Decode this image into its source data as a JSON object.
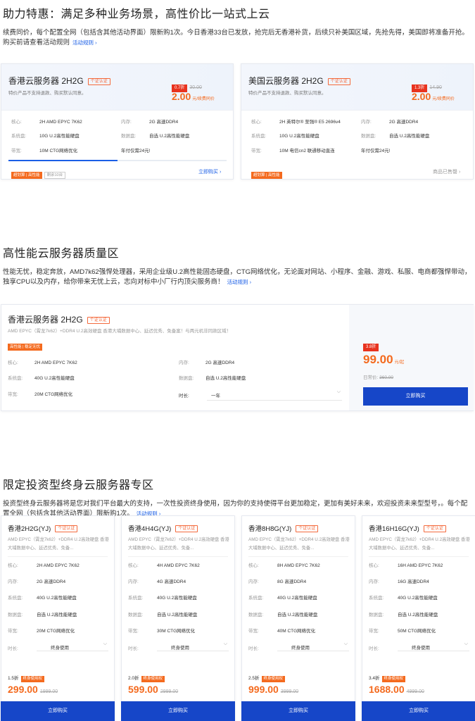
{
  "section1": {
    "title": "助力特惠：满足多种业务场景，高性价比一站式上云",
    "desc": "续费同价，每个配置全网（包括含其他活动界面）限新购1次。今日香港33台已发放，抢完后无香港补货，后续只补美国区域，先抢先得，美国即将准备开抢。购买前请查看活动规则",
    "rules_link": "活动规则 ›",
    "cards": [
      {
        "name": "香港云服务器 2H2G",
        "auth": "个证认证",
        "note": "特价产品不支持退款、购买默认同意。",
        "discount": "0.7折",
        "orig_price": "30.00",
        "price": "2.00",
        "unit": "元/续费同价",
        "specs": {
          "cpu_lbl": "核心:",
          "cpu": "2H AMD EPYC 7K62",
          "mem_lbl": "内存:",
          "mem": "2G 高速DDR4",
          "sys_lbl": "系统盘:",
          "sys": "10G U.2高性能硬盘",
          "data_lbl": "数据盘:",
          "data": "自选 U.2高性能硬盘",
          "bw_lbl": "带宽:",
          "bw": "10M CTG网络优化",
          "extra": "年付仅需24元!"
        },
        "tag1": "超划算 | 高性能",
        "tag2": "剩余10台",
        "progress": 0.5,
        "action": "立即购买 ›"
      },
      {
        "name": "美国云服务器 2H2G",
        "auth": "个证认证",
        "note": "特价产品不支持退款、购买默认同意。",
        "discount": "1.3折",
        "orig_price": "14.90",
        "price": "2.00",
        "unit": "元/续费同价",
        "specs": {
          "cpu_lbl": "核心:",
          "cpu": "2H 英特尔® 至强® E5 2696v4",
          "mem_lbl": "内存:",
          "mem": "2G 高速DDR4",
          "sys_lbl": "系统盘:",
          "sys": "10G U.2高性能硬盘",
          "data_lbl": "数据盘:",
          "data": "自选 U.2高性能硬盘",
          "bw_lbl": "带宽:",
          "bw": "10M 电信cn2 联通移动直连",
          "extra": "年付仅需24元!"
        },
        "tag1": "超划算 | 高性能",
        "action": "商品已售罄 ›"
      }
    ]
  },
  "section2": {
    "title": "高性能云服务器质量区",
    "desc": "性能无忧，稳定奔放，AMD7k62强悍处理器，采用企业级U.2高性能固态硬盘，CTG网络优化，无论面对网站、小程序、金融、游戏、私服、电商都强悍带动，独享CPU以及内存，给你带来无忧上云，志向对标中小厂行内顶尖服务商！",
    "rules_link": "活动规则 ›",
    "card": {
      "name": "香港云服务器 2H2G",
      "auth": "个证认证",
      "desc": "AMD EPYC（霄龙7k62）+DDR4 U.2高效硬盘 香港大埔数据中心、延迟优秀、免备案！与两元机非同款区域！",
      "tag": "高性能 | 稳定无忧",
      "cpu_lbl": "核心:",
      "cpu": "2H AMD EPYC 7K62",
      "mem_lbl": "内存:",
      "mem": "2G 高速DDR4",
      "sys_lbl": "系统盘:",
      "sys": "40G U.2高性能硬盘",
      "data_lbl": "数据盘:",
      "data": "自选 U.2高性能硬盘",
      "bw_lbl": "带宽:",
      "bw": "20M CTG网络优化",
      "dur_lbl": "时长:",
      "dur": "一年",
      "discount": "3.8折",
      "price": "99.00",
      "unit": "元/起",
      "daily_lbl": "日常价:",
      "daily": "360.00",
      "buy": "立即购买"
    }
  },
  "section3": {
    "title": "限定投资型终身云服务器专区",
    "desc": "投资型终身云服务器将是您对我们平台最大的支持，一次性投资终身使用，因为你的支持使得平台更加稳定，更加有美好未来，欢迎投资未来型型号，。每个配置全网（包括含其他活动界面）限新购1次。",
    "rules_link": "活动规则 ›",
    "common": {
      "auth": "个证认证",
      "desc": "AMD EPYC（霄龙7k62）+DDR4 U.2高效硬盘 香港大埔数据中心、延迟优秀、免备...",
      "cpu_lbl": "核心:",
      "mem_lbl": "内存:",
      "sys_lbl": "系统盘:",
      "data_lbl": "数据盘:",
      "bw_lbl": "带宽:",
      "dur_lbl": "时长:",
      "dur": "终身使用",
      "life_tag": "终身使用权",
      "buy": "立即购买"
    },
    "cards": [
      {
        "name": "香港2H2G(YJ)",
        "cpu": "2H AMD EPYC 7K62",
        "mem": "2G 高速DDR4",
        "sys": "40G U.2高性能硬盘",
        "data": "自选 U.2高性能硬盘",
        "bw": "20M CTG网络优化",
        "discount": "1.5折",
        "price": "299.00",
        "orig": "1999.00"
      },
      {
        "name": "香港4H4G(YJ)",
        "cpu": "4H AMD EPYC 7K62",
        "mem": "4G 高速DDR4",
        "sys": "40G U.2高性能硬盘",
        "data": "自选 U.2高性能硬盘",
        "bw": "30M CTG网络优化",
        "discount": "2.0折",
        "price": "599.00",
        "orig": "2999.00"
      },
      {
        "name": "香港8H8G(YJ)",
        "cpu": "8H AMD EPYC 7K62",
        "mem": "8G 高速DDR4",
        "sys": "40G U.2高性能硬盘",
        "data": "自选 U.2高性能硬盘",
        "bw": "40M CTG网络优化",
        "discount": "2.5折",
        "price": "999.00",
        "orig": "3999.00"
      },
      {
        "name": "香港16H16G(YJ)",
        "cpu": "16H AMD EPYC 7K62",
        "mem": "16G 高速DDR4",
        "sys": "40G U.2高性能硬盘",
        "data": "自选 U.2高性能硬盘",
        "bw": "50M CTG网络优化",
        "discount": "3.4折",
        "price": "1688.00",
        "orig": "4999.00"
      }
    ]
  },
  "colors": {
    "accent": "#1646c8",
    "price": "#f46a1e",
    "badge": "#e8331e"
  }
}
